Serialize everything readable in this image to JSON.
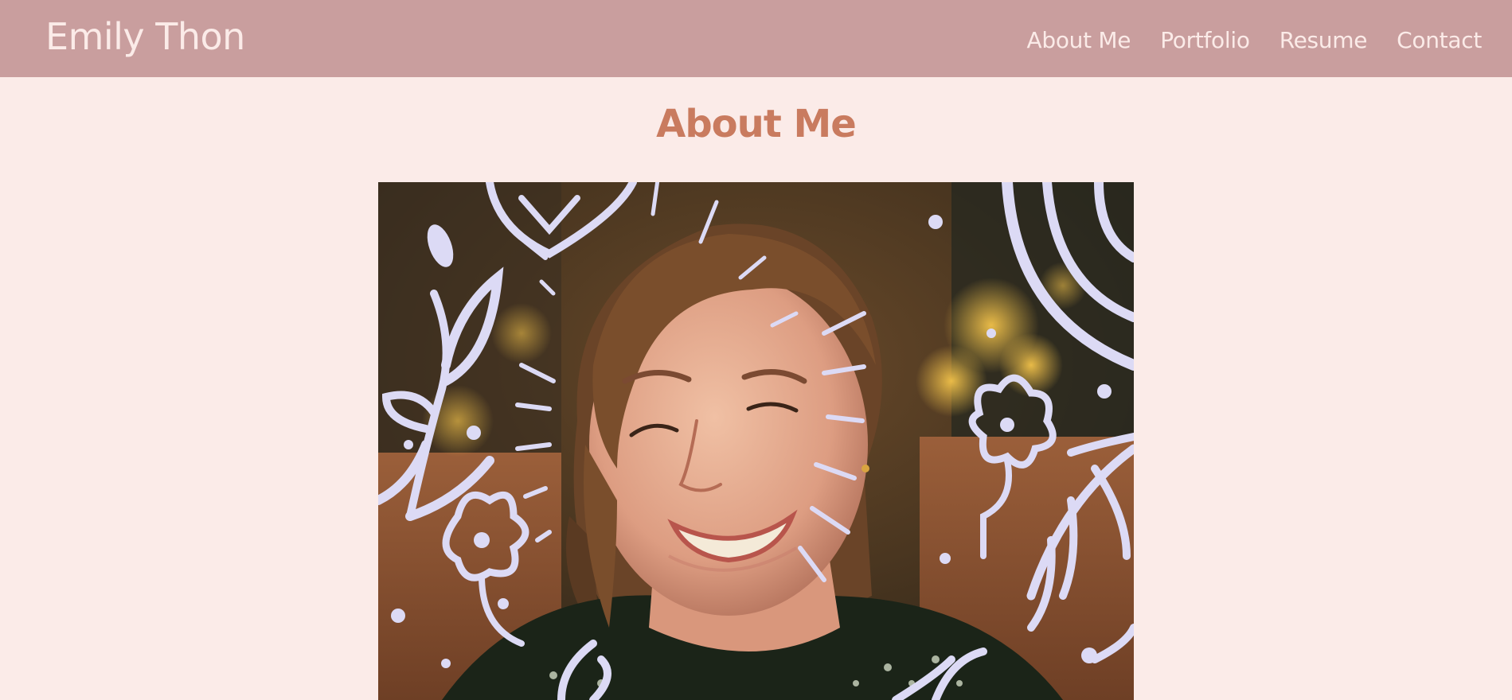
{
  "header": {
    "site_title": "Emily Thon",
    "nav": [
      {
        "label": "About Me"
      },
      {
        "label": "Portfolio"
      },
      {
        "label": "Resume"
      },
      {
        "label": "Contact"
      }
    ]
  },
  "main": {
    "heading": "About Me"
  },
  "colors": {
    "header_bg": "#c99e9e",
    "page_bg": "#fbebe8",
    "heading": "#c97b5f",
    "doodle": "#dcdaf5"
  }
}
